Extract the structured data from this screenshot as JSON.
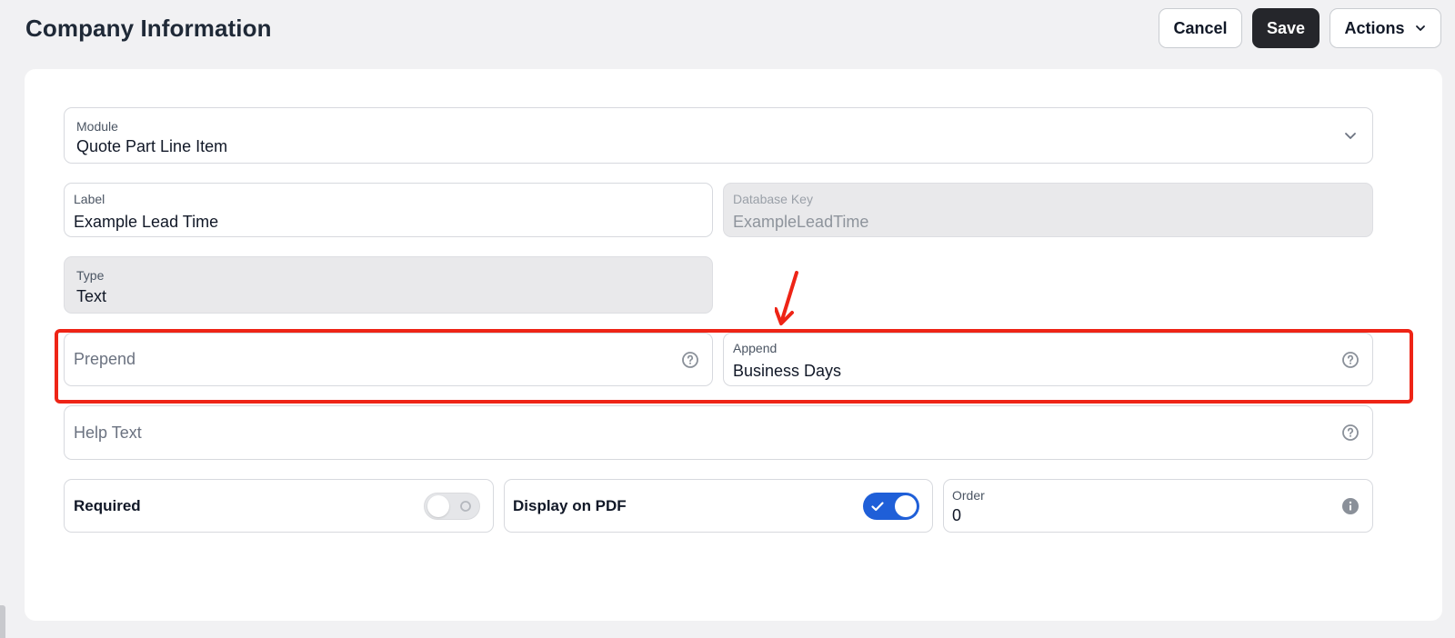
{
  "header": {
    "title": "Company Information",
    "cancel_label": "Cancel",
    "save_label": "Save",
    "actions_label": "Actions"
  },
  "form": {
    "module": {
      "label": "Module",
      "value": "Quote Part Line Item"
    },
    "label_field": {
      "label": "Label",
      "value": "Example Lead Time"
    },
    "database_key": {
      "label": "Database Key",
      "value": "ExampleLeadTime"
    },
    "type": {
      "label": "Type",
      "value": "Text"
    },
    "prepend": {
      "placeholder": "Prepend"
    },
    "append": {
      "label": "Append",
      "value": "Business Days"
    },
    "help_text": {
      "placeholder": "Help Text"
    },
    "required": {
      "label": "Required",
      "enabled": false
    },
    "display_on_pdf": {
      "label": "Display on PDF",
      "enabled": true
    },
    "order": {
      "label": "Order",
      "value": "0"
    }
  },
  "colors": {
    "accent_blue": "#1f5fd8",
    "annotation_red": "#ee2416",
    "save_button": "#25262b"
  },
  "icons": [
    "chevron-down-icon",
    "help-circle-icon",
    "info-icon",
    "check-icon"
  ]
}
